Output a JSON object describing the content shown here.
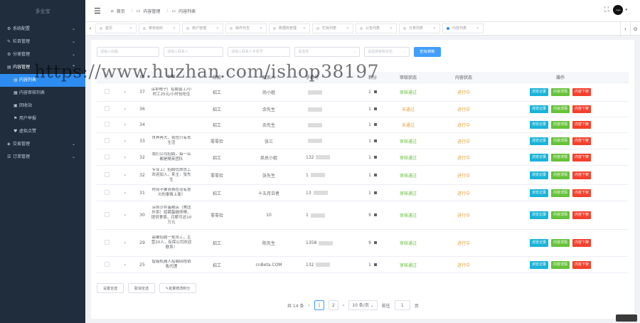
{
  "sidebar": {
    "logo": "多业宝",
    "items": [
      {
        "label": "系统配置",
        "icon": "wrench-icon",
        "glyph": "⚙",
        "arrow": "⌄"
      },
      {
        "label": "栏目管理",
        "icon": "pencil-icon",
        "glyph": "✎",
        "arrow": "⌄"
      },
      {
        "label": "分类管理",
        "icon": "gear-icon",
        "glyph": "⚙",
        "arrow": "⌄"
      },
      {
        "label": "内容管理",
        "icon": "doc-icon",
        "glyph": "▤",
        "arrow": "⌃"
      }
    ],
    "sub_items": [
      {
        "label": "内容列表",
        "icon": "list-icon",
        "glyph": "▦"
      },
      {
        "label": "内容审核列表",
        "icon": "list-icon",
        "glyph": "▦"
      },
      {
        "label": "回收站",
        "icon": "trash-icon",
        "glyph": "▣"
      },
      {
        "label": "用户举报",
        "icon": "flag-icon",
        "glyph": "⚑"
      },
      {
        "label": "虚拟点赞",
        "icon": "heart-icon",
        "glyph": "♥"
      }
    ],
    "bottom_items": [
      {
        "label": "交易管理",
        "icon": "trade-icon",
        "glyph": "◈",
        "arrow": "⌄"
      },
      {
        "label": "订单管理",
        "icon": "cart-icon",
        "glyph": "☰",
        "arrow": "⌄"
      }
    ]
  },
  "header": {
    "breadcrumb": [
      {
        "label": "首页",
        "icon": "home-icon",
        "glyph": "⌂"
      },
      {
        "label": "内容管理",
        "icon": "folder-icon",
        "glyph": "▭"
      },
      {
        "label": "内容列表",
        "icon": "page-icon",
        "glyph": "▭"
      }
    ],
    "avatar_text": "logo"
  },
  "tabs": [
    "首页",
    "菜单组织",
    "用户管理",
    "操作日志",
    "数据库管理",
    "栏目列表",
    "公告列表",
    "分类列表",
    "内容列表"
  ],
  "active_tab": 8,
  "filters": {
    "title_ph": "请输入标题",
    "contact_ph": "请输入联系人",
    "phone_ph": "请输入联系人手机号",
    "select_ph": "请选择",
    "audit_ph": "请选择审核状态",
    "search_btn": "查询/刷新"
  },
  "columns": {
    "id": "ID",
    "title": "标题",
    "category": "栏目",
    "contact": "联系人",
    "phone": "手机号",
    "score": "积分",
    "audit": "审核状态",
    "status": "内容状态",
    "actions": "操作"
  },
  "rows": [
    {
      "id": "37",
      "title": "深圳电子厂招聘普工/小时工25元/小时包吃住",
      "category": "招工",
      "contact": "尚小姐",
      "phone": "",
      "score": "1",
      "audit": "审核通过",
      "audit_cls": "ok",
      "status": "进行中"
    },
    {
      "id": "36",
      "title": "",
      "category": "招工",
      "contact": "余先生",
      "phone": "",
      "score": "1",
      "audit": "未通过",
      "audit_cls": "fail",
      "status": "进行中"
    },
    {
      "id": "34",
      "title": "",
      "category": "招工",
      "contact": "余先生",
      "phone": "",
      "score": "1",
      "audit": "未通过",
      "audit_cls": "fail",
      "status": "进行中"
    },
    {
      "id": "33",
      "title": "世界再大，我也只有去生活",
      "category": "零零捡",
      "contact": "张三",
      "phone": "",
      "score": "1",
      "audit": "审核通过",
      "audit_cls": "ok",
      "status": "进行中"
    },
    {
      "id": "32",
      "title": "我们公司招聘，每一名都是精英团队",
      "category": "招工",
      "contact": "吴总小姐",
      "phone": "132",
      "score": "1",
      "audit": "审核通过",
      "audit_cls": "ok",
      "status": "进行中"
    },
    {
      "id": "32",
      "title": "专业工厂招聘优质员工欢迎加入，来主：张先生",
      "category": "零零捡",
      "contact": "张先生",
      "phone": "1",
      "score": "1",
      "audit": "审核通过",
      "audit_cls": "ok",
      "status": "进行中"
    },
    {
      "id": "31",
      "title": "时间不要浪费在没有意义的事情上面！",
      "category": "招工",
      "contact": "十五月日者",
      "phone": "13",
      "score": "1",
      "audit": "审核通过",
      "audit_cls": "ok",
      "status": "进行中"
    },
    {
      "id": "30",
      "title": "深圳沙井蛋糕店（美团外卖）招聘蛋糕师傅，提供食宿，月薪可达10万元",
      "category": "零零捡",
      "contact": "10",
      "phone": "1",
      "score": "9",
      "audit": "审核通过",
      "audit_cls": "ok",
      "status": "进行中"
    },
    {
      "id": "29",
      "title": "需要招聘一批员工，主营20人，有保公司欢迎联系！",
      "category": "招工",
      "contact": "陈先生",
      "phone": "1358",
      "score": "9",
      "audit": "审核通过",
      "audit_cls": "ok",
      "status": "进行中"
    },
    {
      "id": "25",
      "title": "智能机器人招聘回程销售代理",
      "category": "招工",
      "contact": "cnBeta.COM",
      "phone": "132",
      "score": "1",
      "audit": "审核通过",
      "audit_cls": "ok",
      "status": "进行中"
    }
  ],
  "row_actions": {
    "view": "浏览记录",
    "detail": "内容详情",
    "offline": "内容下架"
  },
  "bottom_buttons": {
    "select_all": "设置全选",
    "deselect_all": "取消全选",
    "batch_edit": "批量修改积分"
  },
  "pagination": {
    "total": "共 14 条",
    "prev": "‹",
    "pages": [
      "1",
      "2"
    ],
    "next": "›",
    "page_size": "10 条/页",
    "jump_label": "前往",
    "jump_value": "1",
    "jump_unit": "页"
  },
  "watermark": "https://www.huzhan.com/ishop38197",
  "colors": {
    "sidebar_bg": "#1f2d3d",
    "accent": "#409eff",
    "view": "#1ab3d8",
    "detail": "#67c23a",
    "offline": "#f5402c"
  }
}
